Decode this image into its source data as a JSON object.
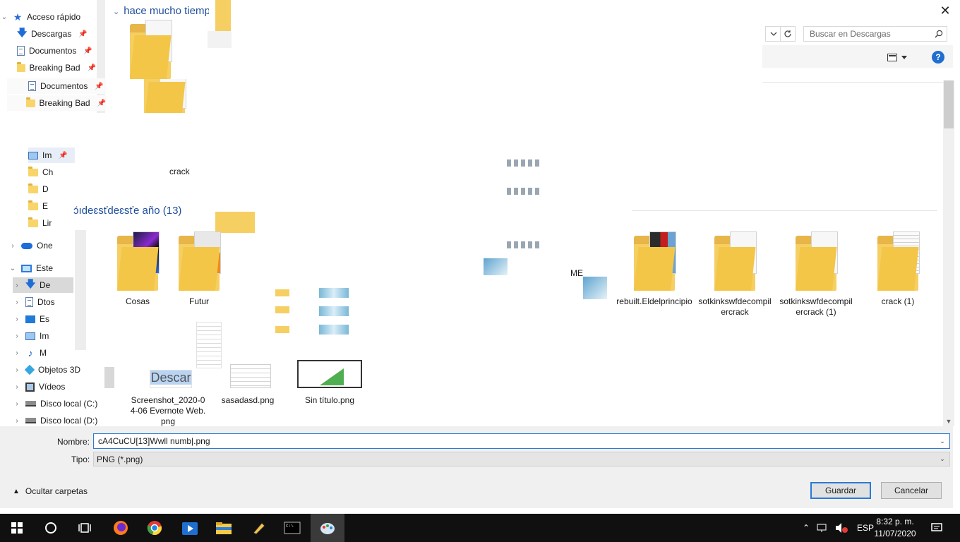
{
  "window": {
    "close_label": "✕"
  },
  "search": {
    "placeholder": "Buscar en Descargas"
  },
  "help_label": "?",
  "nav": {
    "quick_access": "Acceso rápido",
    "items": [
      {
        "label": "Descargas",
        "icon": "download-icon"
      },
      {
        "label": "Documentos",
        "icon": "document-icon"
      },
      {
        "label": "Breaking Bad",
        "icon": "folder-icon"
      },
      {
        "label": "Documentos",
        "icon": "document-icon"
      },
      {
        "label": "Breaking Bad",
        "icon": "folder-icon"
      },
      {
        "label": "Im",
        "icon": "images-icon"
      },
      {
        "label": "Ch",
        "icon": "folder-icon"
      },
      {
        "label": "D",
        "icon": "folder-icon"
      },
      {
        "label": "E",
        "icon": "folder-icon"
      },
      {
        "label": "Lir",
        "icon": "folder-icon"
      }
    ],
    "onedrive": "One",
    "this_pc": "Este",
    "pc_items": [
      {
        "label": "De",
        "icon": "download-icon"
      },
      {
        "label": "Dtos",
        "icon": "document-icon"
      },
      {
        "label": "Es",
        "icon": "desktop-icon"
      },
      {
        "label": "Im",
        "icon": "images-icon"
      },
      {
        "label": "M",
        "icon": "music-icon"
      },
      {
        "label": "Objetos 3D",
        "icon": "cube-icon"
      },
      {
        "label": "Vídeos",
        "icon": "video-icon"
      },
      {
        "label": "Disco local (C:)",
        "icon": "drive-icon"
      },
      {
        "label": "Disco local (D:)",
        "icon": "drive-icon"
      }
    ]
  },
  "content": {
    "group_old": "hace mucho tiemp",
    "group_year": "ɔ́ıdeɛsťdeɛsťe año (13)",
    "folder_crack": "crack",
    "me_label": "ME",
    "tiles": [
      {
        "label": "Cosas"
      },
      {
        "label": "Futur"
      },
      {
        "label": "rebuilt.Eldelprincipio"
      },
      {
        "label": "sotkinkswfdecompilercrack"
      },
      {
        "label": "sotkinkswfdecompilercrack (1)"
      },
      {
        "label": "crack (1)"
      },
      {
        "label": "Screenshot_2020-04-06 Evernote Web.png"
      },
      {
        "label": "sasadasd.png"
      },
      {
        "label": "Sin título.png"
      }
    ],
    "descarga_thumb_text": "Descar"
  },
  "form": {
    "name_label": "Nombre:",
    "name_value": "cA4CuCU[13]Wwll numb|.png",
    "type_label": "Tipo:",
    "type_value": "PNG (*.png)",
    "hide_folders": "Ocultar carpetas",
    "save": "Guardar",
    "cancel": "Cancelar"
  },
  "taskbar": {
    "lang": "ESP",
    "time": "8:32 p. m.",
    "date": "11/07/2020"
  }
}
